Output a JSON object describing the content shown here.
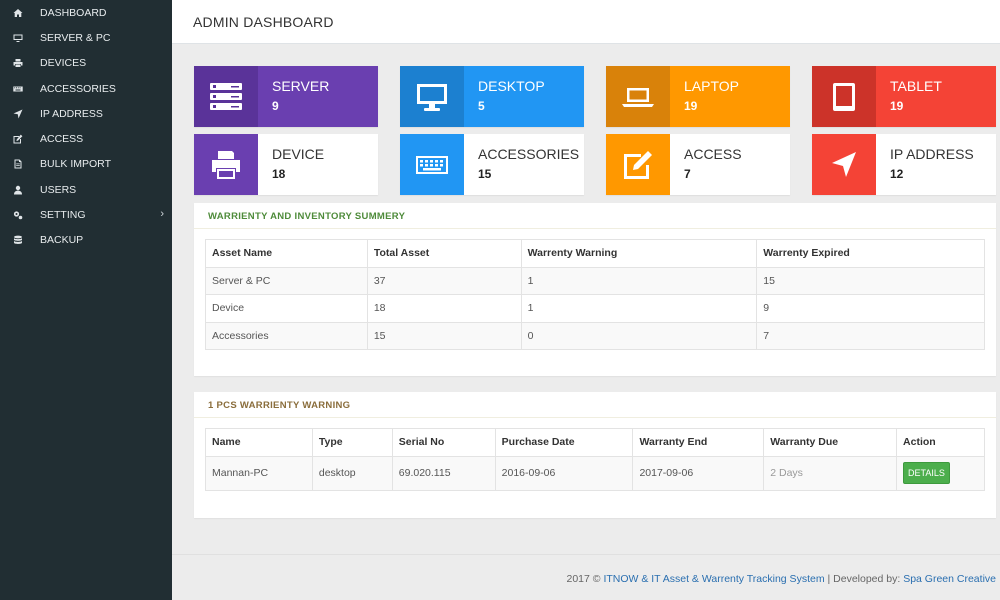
{
  "sidebar": {
    "items": [
      {
        "label": "DASHBOARD",
        "icon": "home-icon"
      },
      {
        "label": "SERVER & PC",
        "icon": "monitor-icon"
      },
      {
        "label": "DEVICES",
        "icon": "printer-icon"
      },
      {
        "label": "ACCESSORIES",
        "icon": "keyboard-icon"
      },
      {
        "label": "IP ADDRESS",
        "icon": "location-arrow-icon"
      },
      {
        "label": "ACCESS",
        "icon": "edit-icon"
      },
      {
        "label": "BULK IMPORT",
        "icon": "file-icon"
      },
      {
        "label": "USERS",
        "icon": "user-icon"
      },
      {
        "label": "SETTING",
        "icon": "gears-icon",
        "chevron": "›"
      },
      {
        "label": "BACKUP",
        "icon": "database-icon"
      }
    ]
  },
  "header": {
    "title": "ADMIN DASHBOARD"
  },
  "cards": [
    {
      "label": "SERVER",
      "value": "9",
      "icon": "server-icon",
      "color": "#6a3fb0"
    },
    {
      "label": "DESKTOP",
      "value": "5",
      "icon": "desktop-icon",
      "color": "#2196f3"
    },
    {
      "label": "LAPTOP",
      "value": "19",
      "icon": "laptop-icon",
      "color": "#ff9800"
    },
    {
      "label": "TABLET",
      "value": "19",
      "icon": "tablet-icon",
      "color": "#f44336"
    },
    {
      "label": "DEVICE",
      "value": "18",
      "icon": "printer-icon",
      "color": "#6a3fb0"
    },
    {
      "label": "ACCESSORIES",
      "value": "15",
      "icon": "keyboard-icon",
      "color": "#2196f3"
    },
    {
      "label": "ACCESS",
      "value": "7",
      "icon": "edit-icon",
      "color": "#ff9800"
    },
    {
      "label": "IP ADDRESS",
      "value": "12",
      "icon": "location-arrow-icon",
      "color": "#f44336"
    }
  ],
  "summary": {
    "heading": "WARRIENTY AND INVENTORY SUMMERY",
    "columns": [
      "Asset Name",
      "Total Asset",
      "Warrenty Warning",
      "Warrenty Expired"
    ],
    "rows": [
      [
        "Server & PC",
        "37",
        "1",
        "15"
      ],
      [
        "Device",
        "18",
        "1",
        "9"
      ],
      [
        "Accessories",
        "15",
        "0",
        "7"
      ]
    ]
  },
  "warning": {
    "heading": "1 PCS WARRIENTY WARNING",
    "columns": [
      "Name",
      "Type",
      "Serial No",
      "Purchase Date",
      "Warranty End",
      "Warranty Due",
      "Action"
    ],
    "rows": [
      [
        "Mannan-PC",
        "desktop",
        "69.020.115",
        "2016-09-06",
        "2017-09-06",
        "2 Days",
        "DETAILS"
      ]
    ]
  },
  "footer": {
    "prefix": "2017 © ",
    "system": "ITNOW & IT Asset & Warrenty Tracking System",
    "middle": " | Developed by: ",
    "developer": "Spa Green Creative"
  }
}
